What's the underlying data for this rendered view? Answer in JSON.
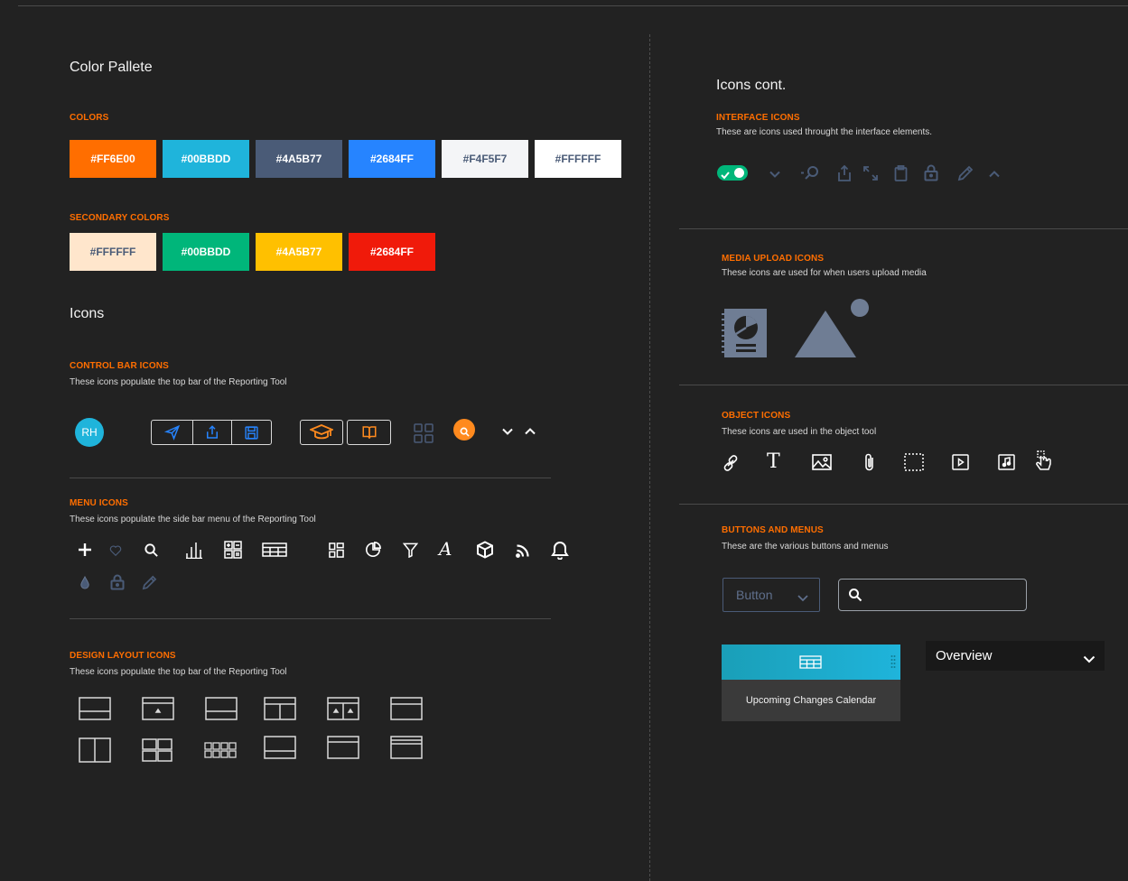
{
  "left": {
    "palette_title": "Color Pallete",
    "colors_label": "COLORS",
    "colors": [
      {
        "label": "#FF6E00",
        "bg": "#FF6E00",
        "fg": "#ffffff"
      },
      {
        "label": "#00BBDD",
        "bg": "#1FB4DB",
        "fg": "#ffffff"
      },
      {
        "label": "#4A5B77",
        "bg": "#4A5B77",
        "fg": "#ffffff"
      },
      {
        "label": "#2684FF",
        "bg": "#2684FF",
        "fg": "#ffffff"
      },
      {
        "label": "#F4F5F7",
        "bg": "#F4F5F7",
        "fg": "#4A5B77"
      },
      {
        "label": "#FFFFFF",
        "bg": "#FFFFFF",
        "fg": "#4A5B77"
      }
    ],
    "secondary_label": "SECONDARY COLORS",
    "secondary_colors": [
      {
        "label": "#FFFFFF",
        "bg": "#FFE6CC",
        "fg": "#4A5B77"
      },
      {
        "label": "#00BBDD",
        "bg": "#00B67A",
        "fg": "#ffffff"
      },
      {
        "label": "#4A5B77",
        "bg": "#FFC000",
        "fg": "#ffffff"
      },
      {
        "label": "#2684FF",
        "bg": "#F01A0A",
        "fg": "#ffffff"
      }
    ],
    "icons_title": "Icons",
    "control_bar": {
      "title": "CONTROL BAR ICONS",
      "desc": "These icons populate the top bar of the Reporting Tool",
      "avatar": "RH"
    },
    "menu_icons": {
      "title": "MENU ICONS",
      "desc": "These icons populate the side bar menu of the Reporting Tool"
    },
    "design_layout": {
      "title": "DESIGN LAYOUT ICONS",
      "desc": "These icons populate the top bar of the Reporting Tool"
    }
  },
  "right": {
    "icons_cont_title": "Icons cont.",
    "interface": {
      "title": "INTERFACE ICONS",
      "desc": "These are icons used throught the interface elements."
    },
    "media_upload": {
      "title": "MEDIA UPLOAD ICONS",
      "desc": "These icons are used for when users upload media"
    },
    "object": {
      "title": "OBJECT ICONS",
      "desc": "These icons are used in the object tool"
    },
    "buttons_menus": {
      "title": "BUTTONS AND MENUS",
      "desc": "These are the various buttons and menus",
      "button_label": "Button",
      "card_label": "Upcoming Changes Calendar",
      "dropdown_value": "Overview"
    }
  },
  "accent": "#FF6E00",
  "icon_color": "#4A5B77"
}
